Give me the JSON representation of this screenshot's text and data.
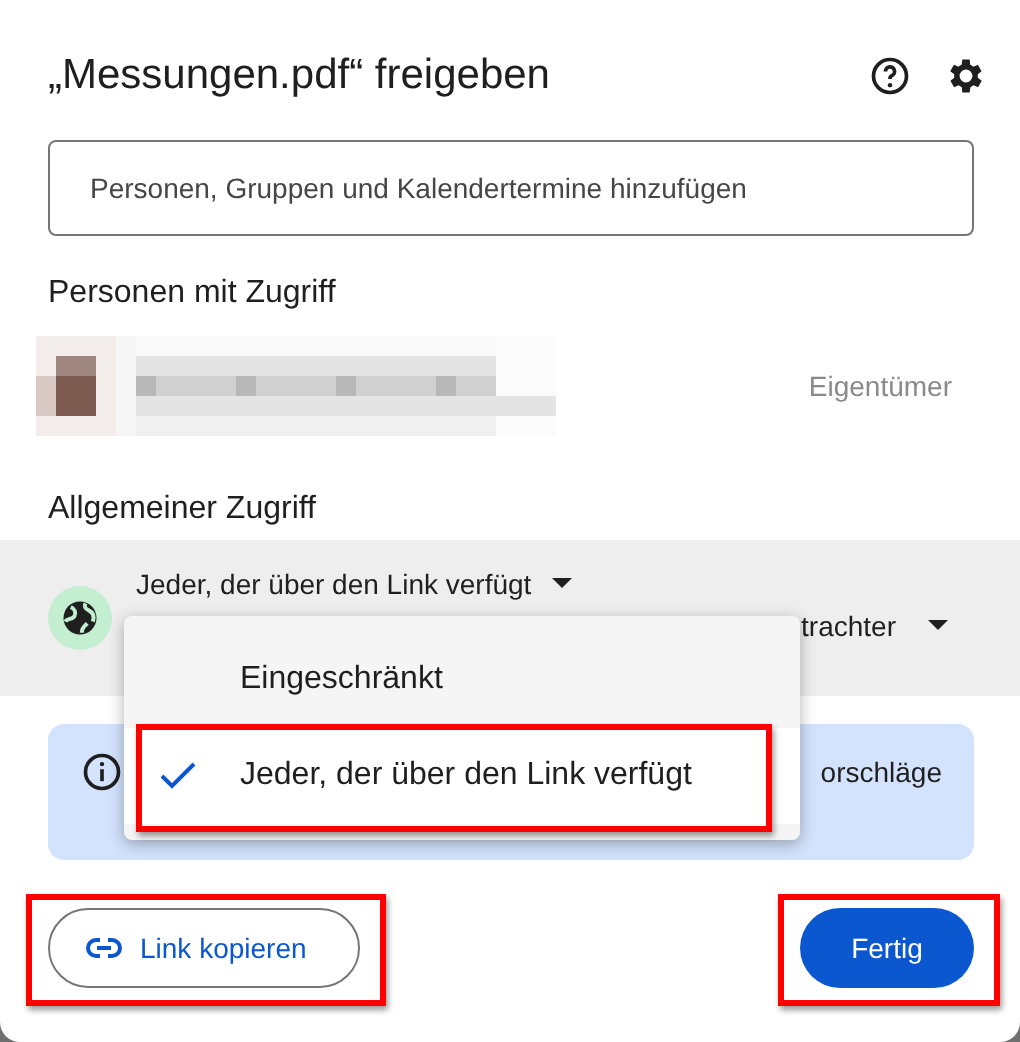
{
  "dialog": {
    "title": "„Messungen.pdf“ freigeben"
  },
  "add_field": {
    "placeholder": "Personen, Gruppen und Kalendertermine hinzufügen"
  },
  "people_section": {
    "heading": "Personen mit Zugriff",
    "people": [
      {
        "role": "Eigentümer"
      }
    ]
  },
  "general_access": {
    "heading": "Allgemeiner Zugriff",
    "access": "Jeder, der über den Link verfügt",
    "role": "trachter",
    "menu": [
      {
        "label": "Eingeschränkt",
        "selected": false,
        "highlighted": false
      },
      {
        "label": "Jeder, der über den Link verfügt",
        "selected": true,
        "highlighted": true
      }
    ]
  },
  "info_banner": {
    "text": "orschläge"
  },
  "buttons": [
    {
      "kind": "outlined",
      "label": "Link kopieren",
      "highlighted": true
    },
    {
      "kind": "filled",
      "label": "Fertig",
      "highlighted": true
    }
  ]
}
